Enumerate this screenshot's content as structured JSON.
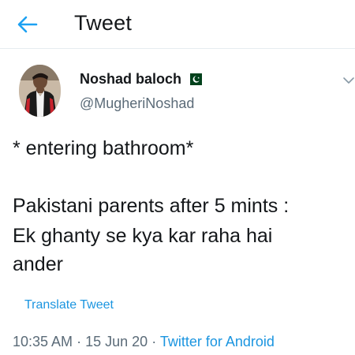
{
  "header": {
    "title": "Tweet",
    "back_icon": "arrow-left-icon",
    "accent": "#1da1f2"
  },
  "author": {
    "display_name": "Noshad baloch",
    "handle": "@MugheriNoshad",
    "flag_icon": "pakistan-flag-icon",
    "avatar_icon": "avatar"
  },
  "tweet": {
    "lines": [
      "* entering bathroom*",
      "Pakistani parents after 5 mints :",
      "Ek ghanty se kya kar raha hai",
      "ander"
    ],
    "translate_label": "Translate Tweet"
  },
  "meta": {
    "time": "10:35 AM",
    "separator": "·",
    "date": "15 Jun 20",
    "app": "Twitter for Android"
  },
  "colors": {
    "link": "#1b95e0",
    "muted": "#5b6b78",
    "text": "#14171a",
    "flag_green": "#01411c"
  }
}
